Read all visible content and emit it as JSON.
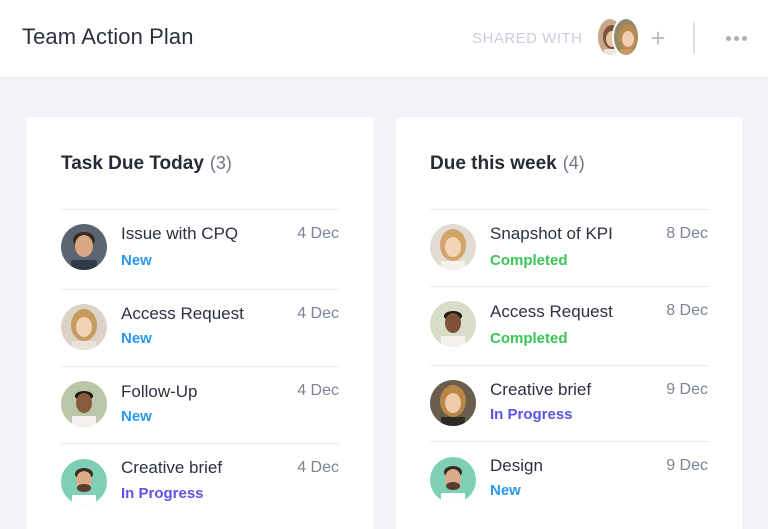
{
  "header": {
    "title": "Team Action Plan",
    "shared_label": "SHARED WITH",
    "add_label": "+"
  },
  "colors": {
    "new": "#2b98f0",
    "in_progress": "#5b52e6",
    "completed": "#3bc457"
  },
  "columns": [
    {
      "title": "Task Due Today",
      "count": "(3)",
      "tasks": [
        {
          "name": "Issue with CPQ",
          "status": "New",
          "date": "4 Dec"
        },
        {
          "name": "Access Request",
          "status": "New",
          "date": "4 Dec"
        },
        {
          "name": "Follow-Up",
          "status": "New",
          "date": "4 Dec"
        },
        {
          "name": "Creative brief",
          "status": "In Progress",
          "date": "4 Dec"
        }
      ]
    },
    {
      "title": "Due this week",
      "count": "(4)",
      "tasks": [
        {
          "name": "Snapshot of KPI",
          "status": "Completed",
          "date": "8 Dec"
        },
        {
          "name": "Access Request",
          "status": "Completed",
          "date": "8 Dec"
        },
        {
          "name": "Creative brief",
          "status": "In Progress",
          "date": "9 Dec"
        },
        {
          "name": "Design",
          "status": "New",
          "date": "9 Dec"
        }
      ]
    }
  ]
}
